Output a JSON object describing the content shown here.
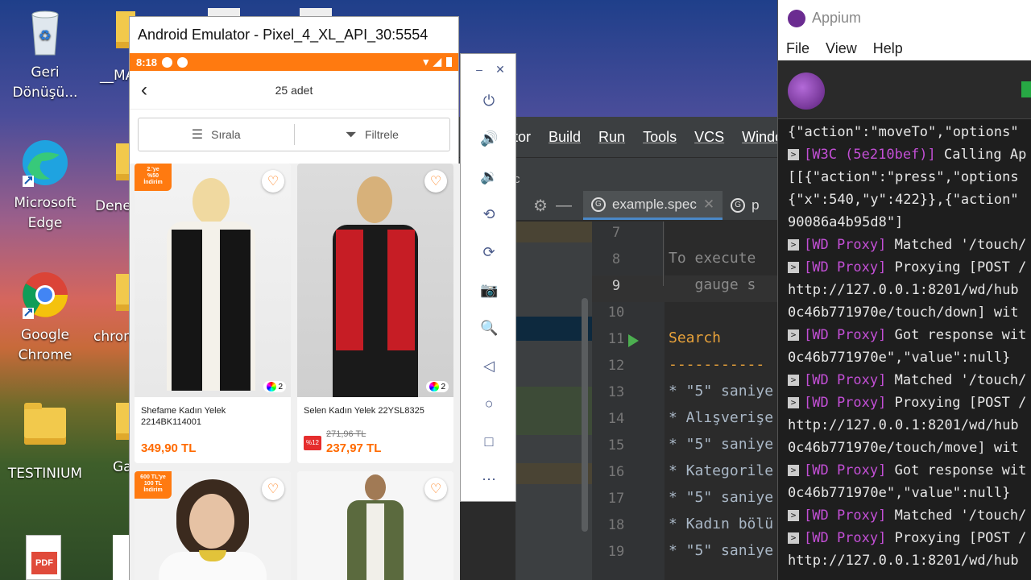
{
  "desktop": {
    "icons": [
      {
        "label": "Geri\nDönüşü..."
      },
      {
        "label": "Microsoft\nEdge"
      },
      {
        "label": "Google\nChrome"
      },
      {
        "label": "TESTINIUM"
      }
    ],
    "partial_labels": [
      "__MA",
      "Dene",
      "chrom",
      "Ga"
    ]
  },
  "ide": {
    "menu": [
      "tor",
      "Build",
      "Run",
      "Tools",
      "VCS",
      "Window"
    ],
    "crumb": "c",
    "tabs": [
      {
        "label": "example.spec"
      },
      {
        "label": "p"
      }
    ],
    "lines": [
      {
        "no": "7",
        "text": ""
      },
      {
        "no": "8",
        "text": "To execute "
      },
      {
        "no": "9",
        "text": "   gauge s"
      },
      {
        "no": "10",
        "text": ""
      },
      {
        "no": "11",
        "text": "Search"
      },
      {
        "no": "12",
        "text": "-----------"
      },
      {
        "no": "13",
        "text": "* \"5\" saniye"
      },
      {
        "no": "14",
        "text": "* Alışverişe"
      },
      {
        "no": "15",
        "text": "* \"5\" saniye"
      },
      {
        "no": "16",
        "text": "* Kategorile"
      },
      {
        "no": "17",
        "text": "* \"5\" saniye"
      },
      {
        "no": "18",
        "text": "* Kadın bölü"
      },
      {
        "no": "19",
        "text": "* \"5\" saniye"
      }
    ]
  },
  "appium": {
    "title": "Appium",
    "menu": [
      "File",
      "View",
      "Help"
    ],
    "log": [
      {
        "tag": "",
        "text": "{\"action\":\"moveTo\",\"options\""
      },
      {
        "tag": "[W3C (5e210bef)]",
        "text": " Calling Ap"
      },
      {
        "tag": "",
        "text": "[[{\"action\":\"press\",\"options"
      },
      {
        "tag": "",
        "text": "{\"x\":540,\"y\":422}},{\"action\""
      },
      {
        "tag": "",
        "text": "90086a4b95d8\"]"
      },
      {
        "tag": "[WD Proxy]",
        "text": " Matched '/touch/"
      },
      {
        "tag": "[WD Proxy]",
        "text": " Proxying [POST /"
      },
      {
        "tag": "",
        "text": "http://127.0.0.1:8201/wd/hub"
      },
      {
        "tag": "",
        "text": "0c46b771970e/touch/down] wit"
      },
      {
        "tag": "[WD Proxy]",
        "text": " Got response wit"
      },
      {
        "tag": "",
        "text": "0c46b771970e\",\"value\":null}"
      },
      {
        "tag": "[WD Proxy]",
        "text": " Matched '/touch/"
      },
      {
        "tag": "[WD Proxy]",
        "text": " Proxying [POST /"
      },
      {
        "tag": "",
        "text": "http://127.0.0.1:8201/wd/hub"
      },
      {
        "tag": "",
        "text": "0c46b771970e/touch/move] wit"
      },
      {
        "tag": "[WD Proxy]",
        "text": " Got response wit"
      },
      {
        "tag": "",
        "text": "0c46b771970e\",\"value\":null}"
      },
      {
        "tag": "[WD Proxy]",
        "text": " Matched '/touch/"
      },
      {
        "tag": "[WD Proxy]",
        "text": " Proxying [POST /"
      },
      {
        "tag": "",
        "text": "http://127.0.0.1:8201/wd/hub"
      }
    ]
  },
  "emulator": {
    "window_title": "Android Emulator - Pixel_4_XL_API_30:5554",
    "status_time": "8:18",
    "appbar_title": "25 adet",
    "sort_label": "Sırala",
    "filter_label": "Filtrele",
    "products": [
      {
        "name": "Shefame Kadın Yelek\n2214BK114001",
        "price": "349,90 TL",
        "old_price": "",
        "discount": "",
        "badge": "2.'ye\n%50\nİndirim",
        "colors": "2"
      },
      {
        "name": "Selen Kadın Yelek 22YSL8325",
        "price": "237,97 TL",
        "old_price": "271,96 TL",
        "discount": "%12",
        "badge": "",
        "colors": "2"
      },
      {
        "name": "",
        "price": "",
        "old_price": "",
        "discount": "",
        "badge": "600 TL'ye\n100 TL\nİndirim",
        "colors": ""
      },
      {
        "name": "",
        "price": "",
        "old_price": "",
        "discount": "",
        "badge": "",
        "colors": ""
      }
    ]
  }
}
